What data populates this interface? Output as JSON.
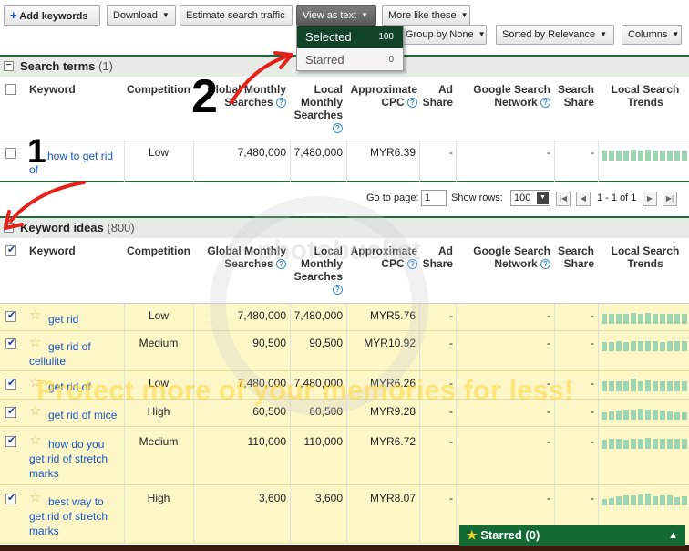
{
  "toolbar": {
    "add_keywords": "Add keywords",
    "download": "Download",
    "estimate": "Estimate search traffic",
    "view_as_text": "View as text",
    "more_like_these": "More like these",
    "group_by": "Group by None",
    "sorted_by": "Sorted by Relevance",
    "columns": "Columns"
  },
  "view_menu": {
    "selected_label": "Selected",
    "selected_count": "100",
    "starred_label": "Starred",
    "starred_count": "0"
  },
  "search_terms": {
    "title": "Search terms",
    "count": "(1)"
  },
  "columns": {
    "keyword": "Keyword",
    "competition": "Competition",
    "global_1": "Global Monthly",
    "global_2": "Searches",
    "local_1": "Local",
    "local_2": "Monthly",
    "local_3": "Searches",
    "cpc_1": "Approximate",
    "cpc_2": "CPC",
    "ad_1": "Ad",
    "ad_2": "Share",
    "gsn_1": "Google Search",
    "gsn_2": "Network",
    "ss_1": "Search",
    "ss_2": "Share",
    "trends_1": "Local Search",
    "trends_2": "Trends"
  },
  "search_term_row": {
    "keyword_1": "how to get rid",
    "keyword_2": "of",
    "competition": "Low",
    "global": "7,480,000",
    "local": "7,480,000",
    "cpc": "MYR6.39",
    "ad_share": "-",
    "gsn": "-",
    "search_share": "-",
    "trend": [
      0.75,
      0.8,
      0.8,
      0.78,
      0.85,
      0.82,
      0.85,
      0.8,
      0.78,
      0.8,
      0.82,
      0.8
    ]
  },
  "pager": {
    "goto_label": "Go to page:",
    "goto_value": "1",
    "rows_label": "Show rows:",
    "rows_value": "100",
    "range": "1 - 1 of 1"
  },
  "keyword_ideas": {
    "title": "Keyword ideas",
    "count": "(800)",
    "rows": [
      {
        "kw1": "get rid",
        "kw2": "",
        "kw3": "",
        "competition": "Low",
        "global": "7,480,000",
        "local": "7,480,000",
        "cpc": "MYR5.76",
        "ad": "-",
        "gsn": "-",
        "ss": "-",
        "trend": [
          0.75,
          0.8,
          0.82,
          0.78,
          0.85,
          0.82,
          0.88,
          0.8,
          0.78,
          0.82,
          0.8,
          0.78
        ]
      },
      {
        "kw1": "get rid of",
        "kw2": "cellulite",
        "kw3": "",
        "competition": "Medium",
        "global": "90,500",
        "local": "90,500",
        "cpc": "MYR10.92",
        "ad": "-",
        "gsn": "-",
        "ss": "-",
        "trend": [
          0.7,
          0.72,
          0.75,
          0.7,
          0.8,
          0.78,
          0.82,
          0.75,
          0.72,
          0.78,
          0.8,
          0.75
        ]
      },
      {
        "kw1": "get rid of",
        "kw2": "",
        "kw3": "",
        "competition": "Low",
        "global": "7,480,000",
        "local": "7,480,000",
        "cpc": "MYR6.26",
        "ad": "-",
        "gsn": "-",
        "ss": "-",
        "trend": [
          0.75,
          0.8,
          0.82,
          0.8,
          1.0,
          0.82,
          0.85,
          0.8,
          0.78,
          0.82,
          0.8,
          0.78
        ]
      },
      {
        "kw1": "get rid of mice",
        "kw2": "",
        "kw3": "",
        "competition": "High",
        "global": "60,500",
        "local": "60,500",
        "cpc": "MYR9.28",
        "ad": "-",
        "gsn": "-",
        "ss": "-",
        "trend": [
          0.6,
          0.65,
          0.7,
          0.75,
          0.8,
          0.85,
          0.82,
          0.78,
          0.7,
          0.65,
          0.6,
          0.58
        ]
      },
      {
        "kw1": "how do you",
        "kw2": "get rid of stretch",
        "kw3": "marks",
        "competition": "Medium",
        "global": "110,000",
        "local": "110,000",
        "cpc": "MYR6.72",
        "ad": "-",
        "gsn": "-",
        "ss": "-",
        "trend": [
          0.7,
          0.75,
          0.78,
          0.72,
          0.8,
          0.82,
          0.85,
          0.8,
          0.78,
          0.75,
          0.8,
          0.78
        ]
      },
      {
        "kw1": "best way to",
        "kw2": "get rid of stretch",
        "kw3": "marks",
        "competition": "High",
        "global": "3,600",
        "local": "3,600",
        "cpc": "MYR8.07",
        "ad": "-",
        "gsn": "-",
        "ss": "-",
        "trend": [
          0.5,
          0.6,
          0.7,
          0.8,
          0.75,
          0.85,
          0.9,
          0.7,
          0.8,
          0.75,
          0.65,
          0.7
        ]
      }
    ]
  },
  "starred_bar": {
    "label": "Starred (0)"
  },
  "annotations": {
    "one": "1",
    "two": "2"
  },
  "watermark": {
    "text": "Protect more of your memories for less!",
    "brand": "photobucket"
  },
  "colors": {
    "accent_green": "#146a34",
    "selected_row": "#fdf7c8",
    "link_blue": "#1a55c5",
    "arrow_red": "#e8201a"
  }
}
